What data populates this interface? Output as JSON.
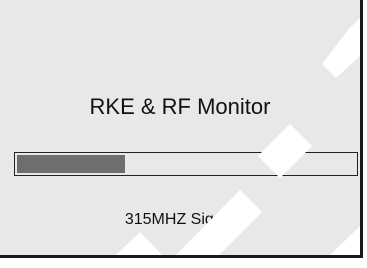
{
  "screen": {
    "title": "RKE & RF Monitor",
    "signal_label": "315MHZ Signal",
    "signal_strength_fraction": 0.32
  },
  "colors": {
    "background": "#e8e8e8",
    "bar_fill": "#6e6e6e",
    "text": "#111111"
  }
}
